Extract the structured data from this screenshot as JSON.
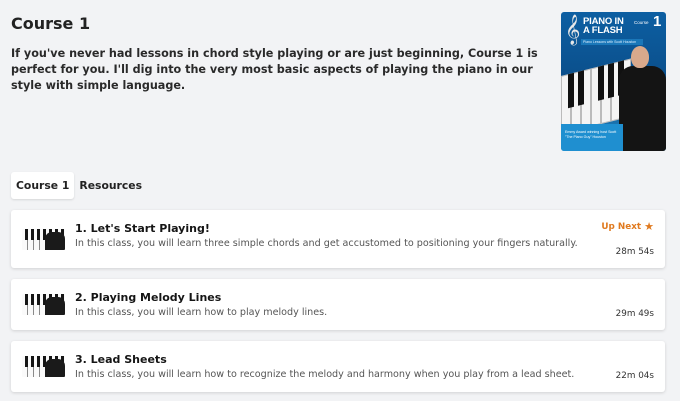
{
  "course": {
    "title": "Course 1",
    "description": "If you've never had lessons in chord style playing or are just beginning, Course 1 is perfect for you. I'll dig into the very most basic aspects of playing the piano in our style with simple language."
  },
  "cover": {
    "title": "PIANO IN A FLASH",
    "tag": "Course",
    "number": "1",
    "subtitle": "Piano Lessons with Scott Houston",
    "bottom_text": "Emmy Award winning host Scott \"The Piano Guy\" Houston",
    "colors": {
      "primary": "#0d5fa2",
      "accent": "#2a9ad8"
    }
  },
  "tabs": [
    {
      "label": "Course 1",
      "active": true
    },
    {
      "label": "Resources",
      "active": false
    }
  ],
  "lessons": [
    {
      "title": "1. Let's Start Playing!",
      "description": "In this class, you will learn three simple chords and get accustomed to positioning your fingers naturally.",
      "duration": "28m 54s",
      "badge": "Up Next",
      "badge_icon": "star-icon"
    },
    {
      "title": "2. Playing Melody Lines",
      "description": "In this class, you will learn how to play melody lines.",
      "duration": "29m 49s"
    },
    {
      "title": "3. Lead Sheets",
      "description": "In this class, you will learn how to recognize the melody and harmony when you play from a lead sheet.",
      "duration": "22m 04s"
    }
  ],
  "colors": {
    "background": "#f2f3f5",
    "card": "#ffffff",
    "up_next": "#e07a1f"
  }
}
